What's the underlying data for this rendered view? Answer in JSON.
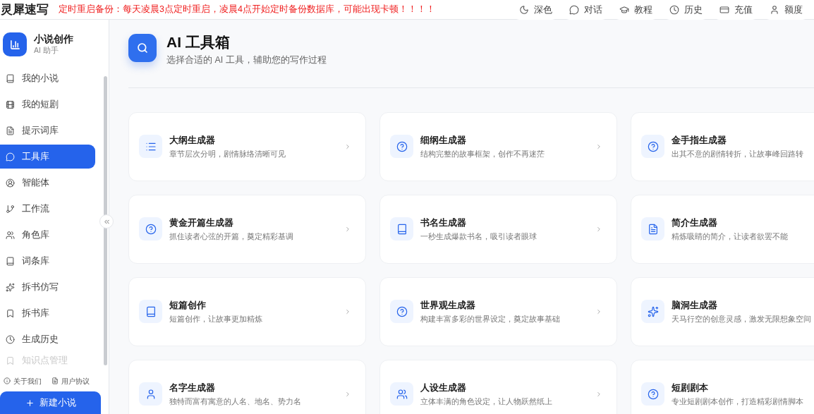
{
  "brand": "灵犀速写",
  "notice": "定时重启备份：每天凌晨3点定时重启，凌晨4点开始定时备份数据库，可能出现卡顿！！！！",
  "top_actions": [
    {
      "label": "深色"
    },
    {
      "label": "对话"
    },
    {
      "label": "教程"
    },
    {
      "label": "历史"
    },
    {
      "label": "充值"
    },
    {
      "label": "额度"
    }
  ],
  "sidebar": {
    "title": "小说创作",
    "subtitle": "AI 助手",
    "items": [
      {
        "label": "我的小说",
        "selected": false
      },
      {
        "label": "我的短剧",
        "selected": false
      },
      {
        "label": "提示词库",
        "selected": false
      },
      {
        "label": "工具库",
        "selected": true
      },
      {
        "label": "智能体",
        "selected": false
      },
      {
        "label": "工作流",
        "selected": false
      },
      {
        "label": "角色库",
        "selected": false
      },
      {
        "label": "词条库",
        "selected": false
      },
      {
        "label": "拆书仿写",
        "selected": false
      },
      {
        "label": "拆书库",
        "selected": false
      },
      {
        "label": "生成历史",
        "selected": false
      },
      {
        "label": "知识点管理",
        "selected": false
      }
    ],
    "footer_links": [
      "关于我们",
      "用户协议"
    ],
    "new_button": "新建小说"
  },
  "page": {
    "title": "AI 工具箱",
    "subtitle": "选择合适的 AI 工具，辅助您的写作过程"
  },
  "tools": [
    {
      "title": "大纲生成器",
      "description": "章节层次分明，剧情脉络清晰可见"
    },
    {
      "title": "细纲生成器",
      "description": "结构完整的故事框架，创作不再迷茫"
    },
    {
      "title": "金手指生成器",
      "description": "出其不意的剧情转折，让故事峰回路转"
    },
    {
      "title": "黄金开篇生成器",
      "description": "抓住读者心弦的开篇，奠定精彩基调"
    },
    {
      "title": "书名生成器",
      "description": "一秒生成爆款书名，吸引读者眼球"
    },
    {
      "title": "简介生成器",
      "description": "精炼吸睛的简介，让读者欲罢不能"
    },
    {
      "title": "短篇创作",
      "description": "短篇创作，让故事更加精炼"
    },
    {
      "title": "世界观生成器",
      "description": "构建丰富多彩的世界设定，奠定故事基础"
    },
    {
      "title": "脑洞生成器",
      "description": "天马行空的创意灵感，激发无限想象空间"
    },
    {
      "title": "名字生成器",
      "description": "独特而富有寓意的人名、地名、势力名"
    },
    {
      "title": "人设生成器",
      "description": "立体丰满的角色设定，让人物跃然纸上"
    },
    {
      "title": "短剧剧本",
      "description": "专业短剧剧本创作，打造精彩剧情脚本"
    }
  ]
}
